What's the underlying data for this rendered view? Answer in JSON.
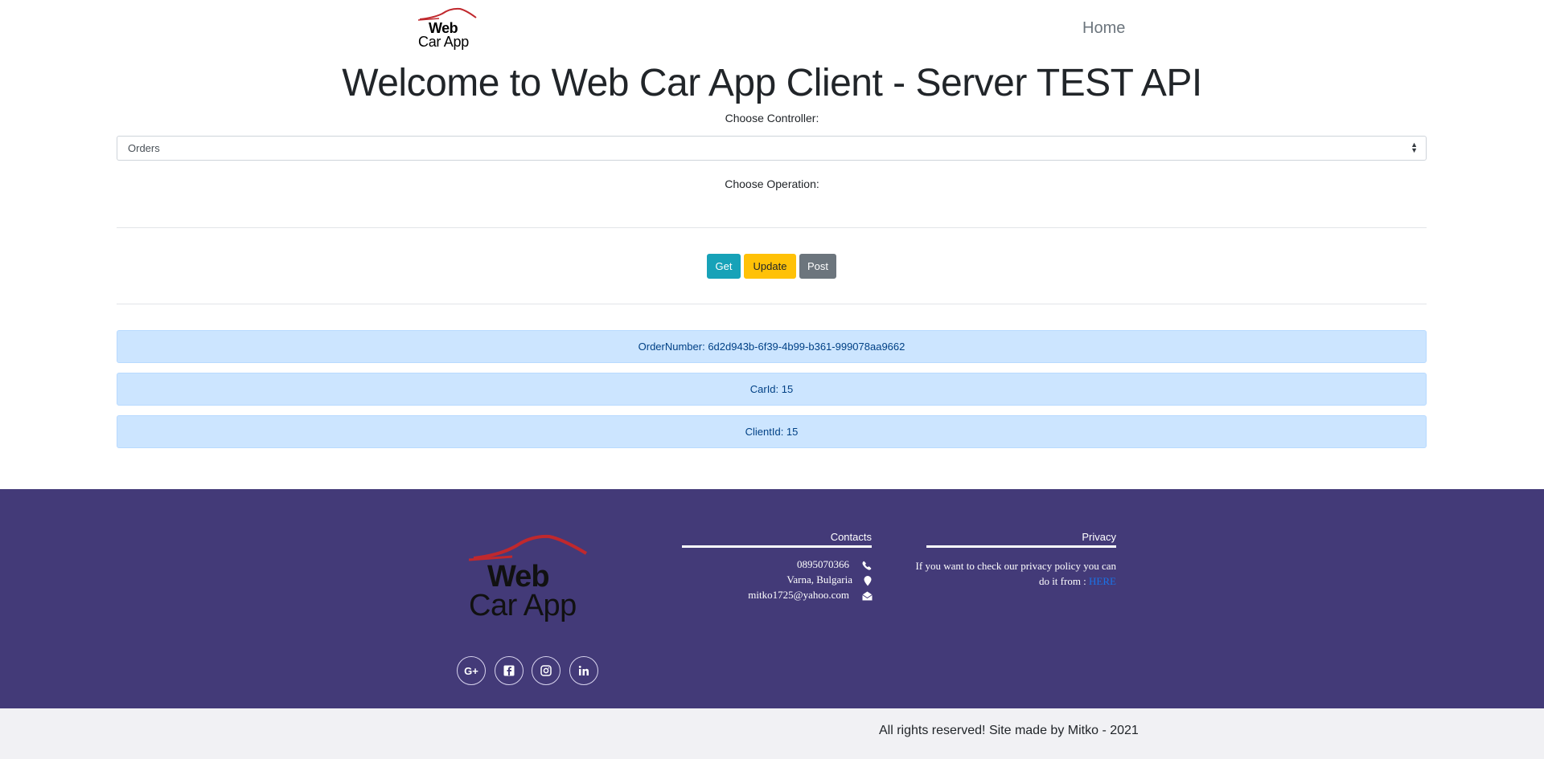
{
  "header": {
    "logo_line1": "Web",
    "logo_line2": "Car App",
    "nav_home": "Home"
  },
  "main": {
    "title": "Welcome to Web Car App Client - Server TEST API",
    "controller_label": "Choose Controller:",
    "controller_selected": "Orders",
    "operation_label": "Choose Operation:",
    "buttons": {
      "get": "Get",
      "update": "Update",
      "post": "Post"
    },
    "results": [
      "OrderNumber: 6d2d943b-6f39-4b99-b361-999078aa9662",
      "CarId: 15",
      "ClientId: 15"
    ]
  },
  "footer": {
    "logo_line1": "Web",
    "logo_line2": "Car App",
    "social_icons": [
      "google-plus-icon",
      "facebook-icon",
      "instagram-icon",
      "linkedin-icon"
    ],
    "contacts": {
      "title": "Contacts",
      "phone": "0895070366",
      "address": "Varna, Bulgaria",
      "email": "mitko1725@yahoo.com"
    },
    "privacy": {
      "title": "Privacy",
      "text": "If you want to check our privacy policy you can do it from : ",
      "link": "HERE"
    },
    "copyright": "All rights reserved! Site made by Mitko - 2021"
  },
  "colors": {
    "footer_bg": "#433a78",
    "get_button": "#17a2b8",
    "update_button": "#ffc107",
    "post_button": "#6c757d",
    "result_bg": "#cce5ff",
    "logo_roof": "#c0282d"
  }
}
